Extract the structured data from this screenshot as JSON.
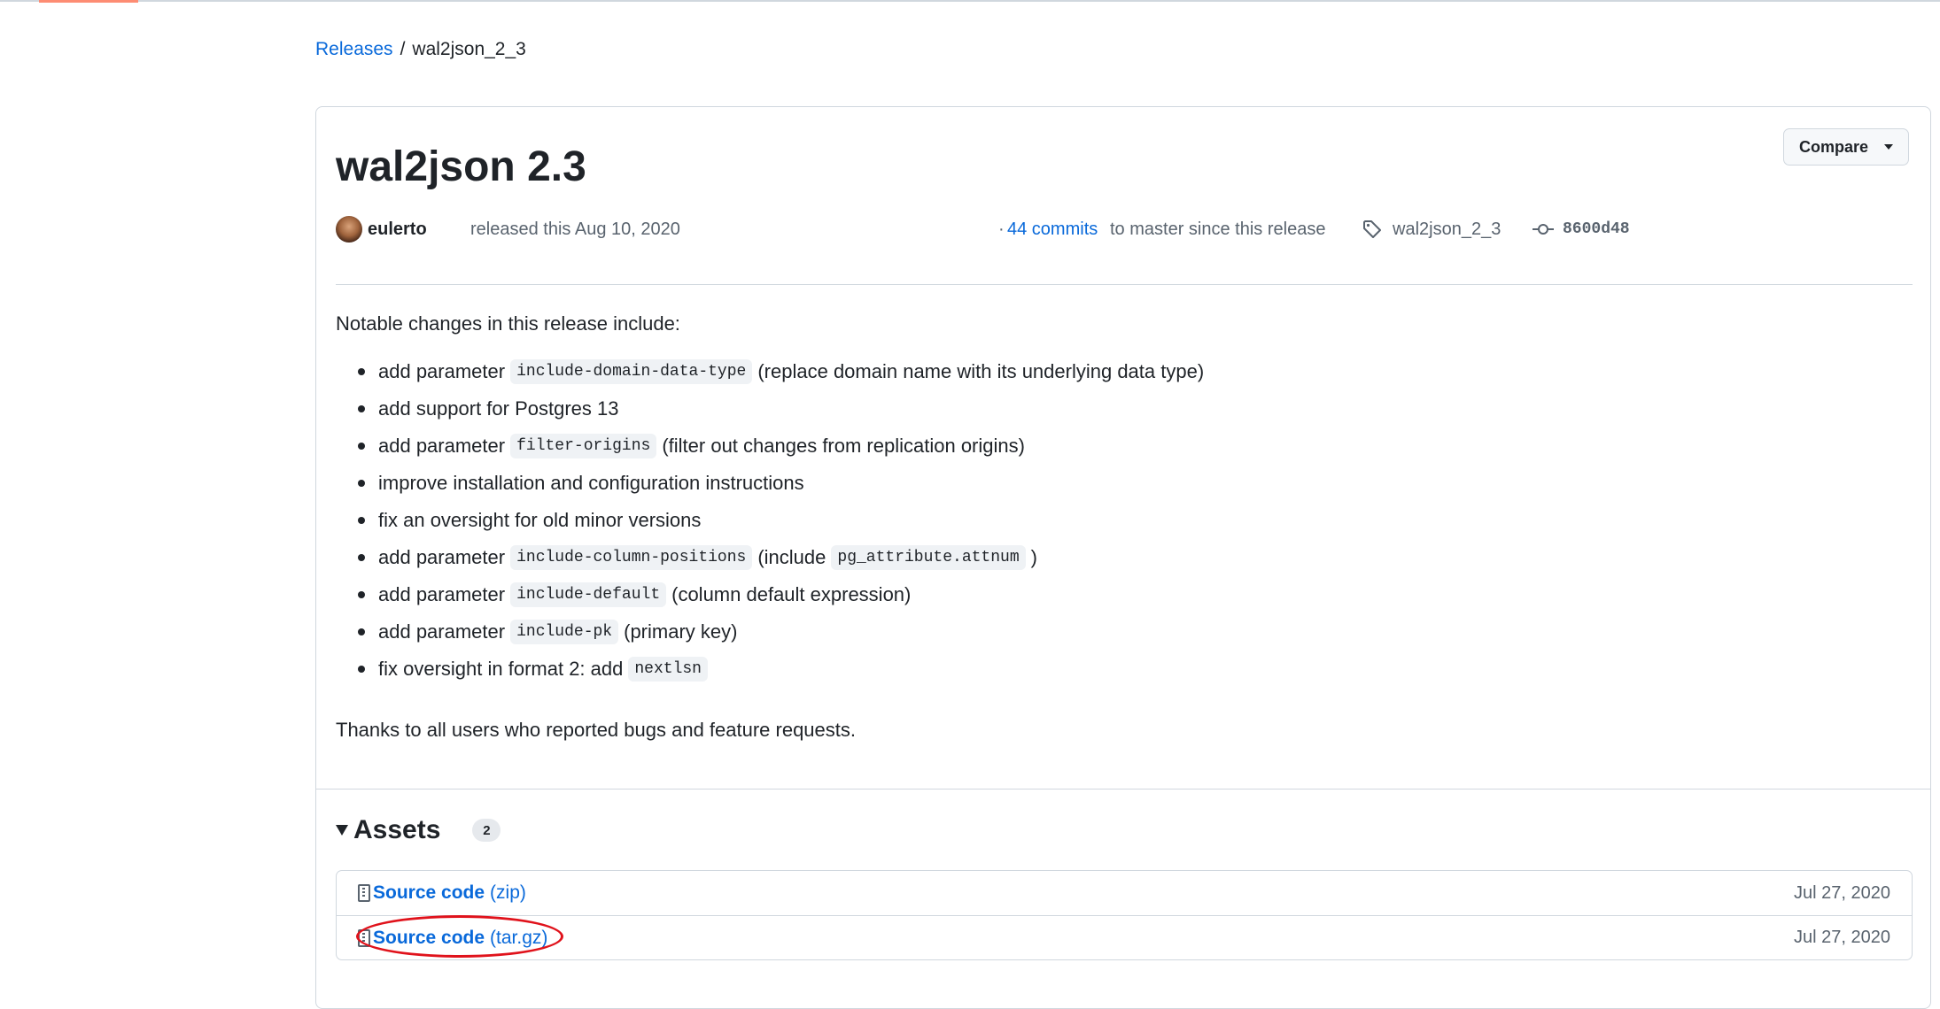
{
  "breadcrumb": {
    "parent": "Releases",
    "separator": "/",
    "current": "wal2json_2_3"
  },
  "release": {
    "title": "wal2json 2.3",
    "compare_label": "Compare",
    "author": "eulerto",
    "released_text": "released this Aug 10, 2020",
    "commits_prefix": "·",
    "commits_link": "44 commits",
    "commits_suffix": "to master since this release",
    "tag": "wal2json_2_3",
    "commit_sha": "8600d48"
  },
  "notes": {
    "intro": "Notable changes in this release include:",
    "items": [
      {
        "pre": "add parameter",
        "code": "include-domain-data-type",
        "post": "(replace domain name with its underlying data type)"
      },
      {
        "pre": "add support for Postgres 13"
      },
      {
        "pre": "add parameter",
        "code": "filter-origins",
        "post": "(filter out changes from replication origins)"
      },
      {
        "pre": "improve installation and configuration instructions"
      },
      {
        "pre": "fix an oversight for old minor versions"
      },
      {
        "pre": "add parameter",
        "code": "include-column-positions",
        "post": "(include",
        "code2": "pg_attribute.attnum",
        "post2": ")"
      },
      {
        "pre": "add parameter",
        "code": "include-default",
        "post": "(column default expression)"
      },
      {
        "pre": "add parameter",
        "code": "include-pk",
        "post": "(primary key)"
      },
      {
        "pre": "fix oversight in format 2: add",
        "code": "nextlsn"
      }
    ],
    "outro": "Thanks to all users who reported bugs and feature requests."
  },
  "assets": {
    "heading": "Assets",
    "count": "2",
    "items": [
      {
        "name": "Source code",
        "ext": "(zip)",
        "date": "Jul 27, 2020"
      },
      {
        "name": "Source code",
        "ext": "(tar.gz)",
        "date": "Jul 27, 2020"
      }
    ]
  },
  "icons": {
    "tag": "tag-icon",
    "commit": "git-commit-icon",
    "file_zip": "file-zip-icon",
    "caret": "triangle-down-icon"
  },
  "colors": {
    "link": "#0969da",
    "text": "#1f2328",
    "muted": "#59636e",
    "border": "#d0d7de",
    "annotation": "#e0121b"
  }
}
